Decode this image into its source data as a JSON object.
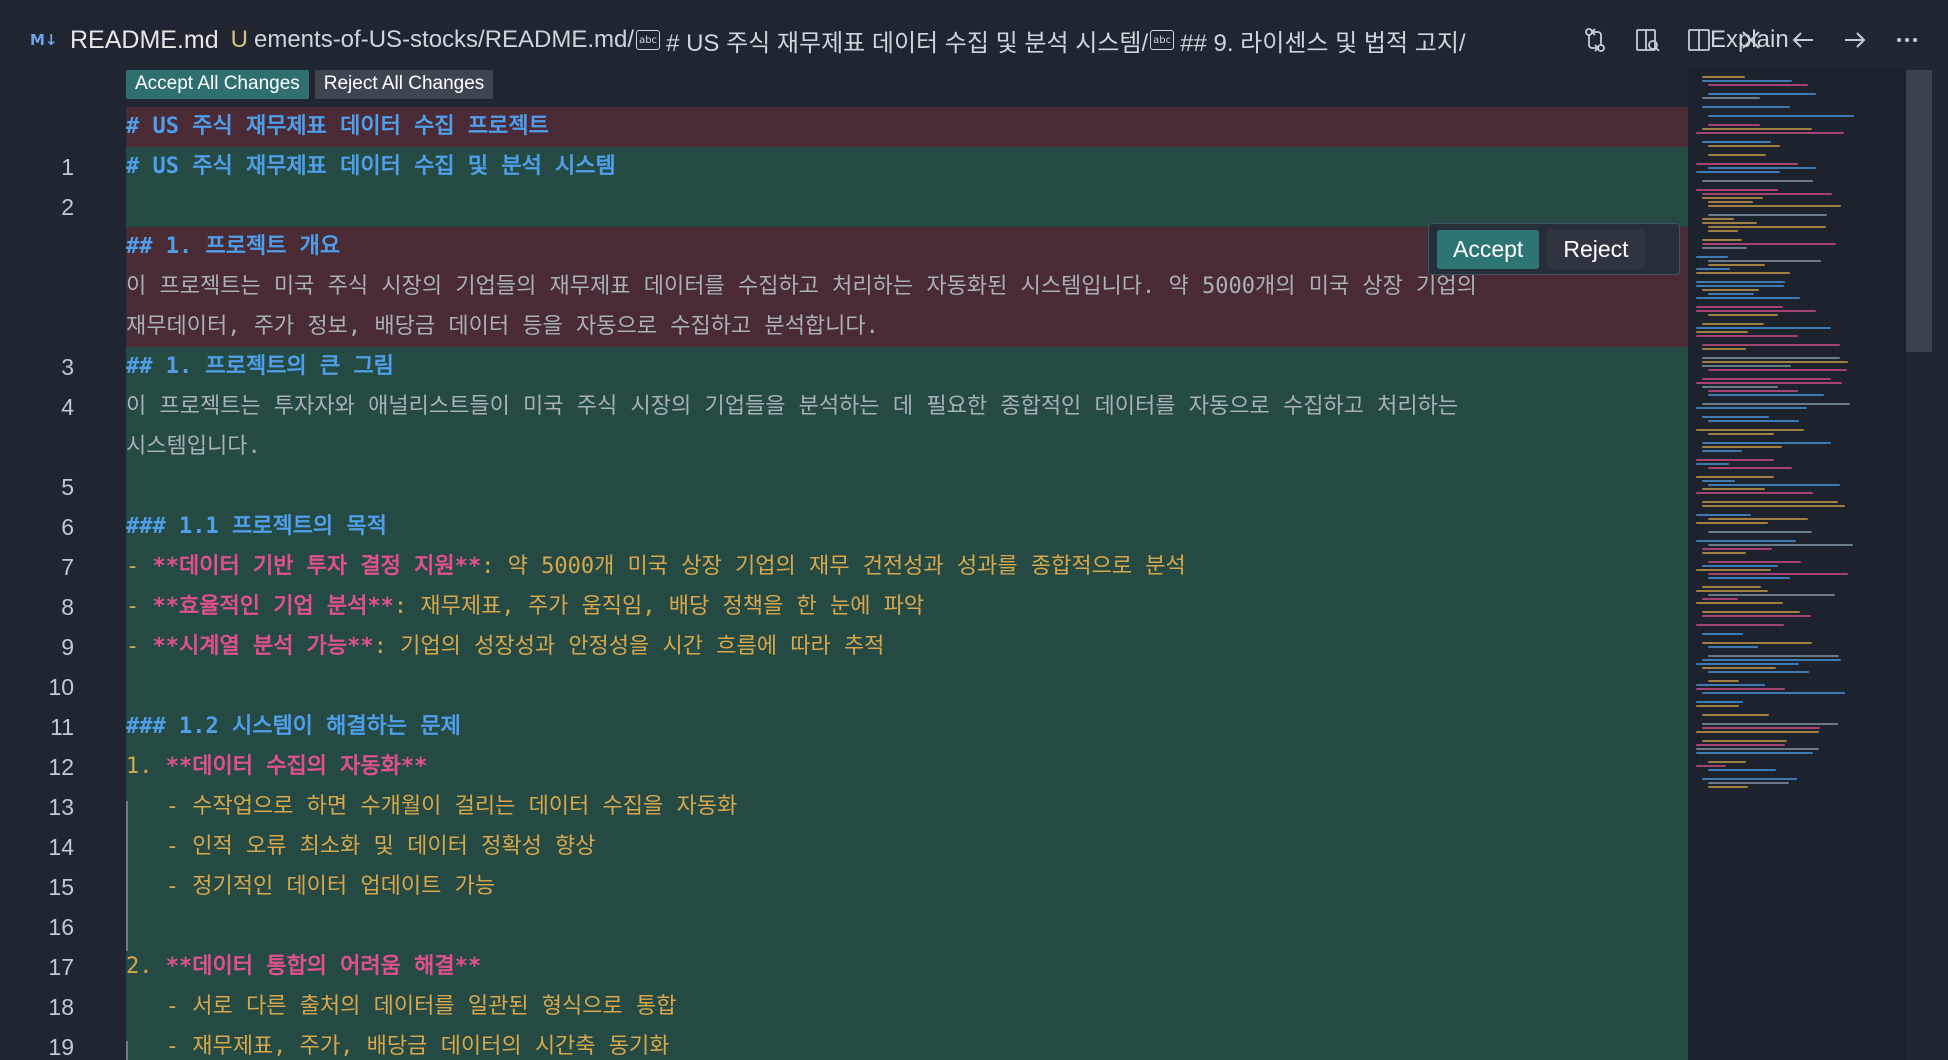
{
  "titlebar": {
    "md_icon": "M↓",
    "file_name": "README.md",
    "file_status": "U",
    "crumbs": [
      {
        "text": "ements-of-US-stocks/README.md/"
      },
      {
        "text": "# US 주식 재무제표 데이터 수집 및 분석 시스템/"
      },
      {
        "text": "## 9. 라이센스 및 법적 고지/"
      }
    ],
    "abc_label": "abc",
    "explain": "Explain"
  },
  "toolbar_icons": [
    "source-control-compare-icon",
    "open-preview-icon",
    "split-editor-icon",
    "close-icon",
    "go-back-icon",
    "go-forward-icon",
    "more-actions-icon"
  ],
  "diff_actions": {
    "accept_all": "Accept All Changes",
    "reject_all": "Reject All Changes"
  },
  "hunk_actions": {
    "accept": "Accept",
    "reject": "Reject"
  },
  "lines": [
    {
      "n": "",
      "kind": "del",
      "segments": [
        {
          "c": "h-blue",
          "t": "# US 주식 재무제표 데이터 수집 프로젝트"
        }
      ]
    },
    {
      "n": "1",
      "kind": "add",
      "segments": [
        {
          "c": "h-blue",
          "t": "# US 주식 재무제표 데이터 수집 및 분석 시스템"
        }
      ]
    },
    {
      "n": "2",
      "kind": "add",
      "segments": []
    },
    {
      "n": "",
      "kind": "del",
      "segments": [
        {
          "c": "h-blue",
          "t": "## 1. 프로젝트 개요"
        }
      ]
    },
    {
      "n": "",
      "kind": "del",
      "segments": [
        {
          "c": "grey",
          "t": "이 프로젝트는 미국 주식 시장의 기업들의 재무제표 데이터를 수집하고 처리하는 자동화된 시스템입니다. 약 5000개의 미국 상장 기업의"
        }
      ]
    },
    {
      "n": "",
      "kind": "del",
      "segments": [
        {
          "c": "grey",
          "t": "재무데이터, 주가 정보, 배당금 데이터 등을 자동으로 수집하고 분석합니다."
        }
      ]
    },
    {
      "n": "3",
      "kind": "add",
      "segments": [
        {
          "c": "h-blue",
          "t": "## 1. 프로젝트의 큰 그림"
        }
      ]
    },
    {
      "n": "4",
      "kind": "add",
      "segments": [
        {
          "c": "grey",
          "t": "이 프로젝트는 투자자와 애널리스트들이 미국 주식 시장의 기업들을 분석하는 데 필요한 종합적인 데이터를 자동으로 수집하고 처리하는"
        }
      ]
    },
    {
      "n": "",
      "kind": "add",
      "segments": [
        {
          "c": "grey",
          "t": "시스템입니다."
        }
      ]
    },
    {
      "n": "5",
      "kind": "add",
      "segments": []
    },
    {
      "n": "6",
      "kind": "add",
      "segments": [
        {
          "c": "h-blue",
          "t": "### 1.1 프로젝트의 목적"
        }
      ]
    },
    {
      "n": "7",
      "kind": "add",
      "segments": [
        {
          "c": "orange",
          "t": "- "
        },
        {
          "c": "pink",
          "t": "**데이터 기반 투자 결정 지원**"
        },
        {
          "c": "orange",
          "t": ": 약 5000개 미국 상장 기업의 재무 건전성과 성과를 종합적으로 분석"
        }
      ]
    },
    {
      "n": "8",
      "kind": "add",
      "segments": [
        {
          "c": "orange",
          "t": "- "
        },
        {
          "c": "pink",
          "t": "**효율적인 기업 분석**"
        },
        {
          "c": "orange",
          "t": ": 재무제표, 주가 움직임, 배당 정책을 한 눈에 파악"
        }
      ]
    },
    {
      "n": "9",
      "kind": "add",
      "segments": [
        {
          "c": "orange",
          "t": "- "
        },
        {
          "c": "pink",
          "t": "**시계열 분석 가능**"
        },
        {
          "c": "orange",
          "t": ": 기업의 성장성과 안정성을 시간 흐름에 따라 추적"
        }
      ]
    },
    {
      "n": "10",
      "kind": "add",
      "segments": []
    },
    {
      "n": "11",
      "kind": "add",
      "segments": [
        {
          "c": "h-blue",
          "t": "### 1.2 시스템이 해결하는 문제"
        }
      ]
    },
    {
      "n": "12",
      "kind": "add",
      "segments": [
        {
          "c": "orange",
          "t": "1. "
        },
        {
          "c": "pink",
          "t": "**데이터 수집의 자동화**"
        }
      ]
    },
    {
      "n": "13",
      "kind": "add",
      "segments": [
        {
          "c": "orange",
          "t": "   - 수작업으로 하면 수개월이 걸리는 데이터 수집을 자동화"
        }
      ]
    },
    {
      "n": "14",
      "kind": "add",
      "segments": [
        {
          "c": "orange",
          "t": "   - 인적 오류 최소화 및 데이터 정확성 향상"
        }
      ]
    },
    {
      "n": "15",
      "kind": "add",
      "segments": [
        {
          "c": "orange",
          "t": "   - 정기적인 데이터 업데이트 가능"
        }
      ]
    },
    {
      "n": "16",
      "kind": "add",
      "segments": []
    },
    {
      "n": "17",
      "kind": "add",
      "segments": [
        {
          "c": "orange",
          "t": "2. "
        },
        {
          "c": "pink",
          "t": "**데이터 통합의 어려움 해결**"
        }
      ]
    },
    {
      "n": "18",
      "kind": "add",
      "segments": [
        {
          "c": "orange",
          "t": "   - 서로 다른 출처의 데이터를 일관된 형식으로 통합"
        }
      ]
    },
    {
      "n": "19",
      "kind": "add",
      "segments": [
        {
          "c": "orange",
          "t": "   - 재무제표, 주가, 배당금 데이터의 시간축 동기화"
        }
      ]
    }
  ],
  "colors": {
    "background": "#1f2631",
    "added_line": "#254a43",
    "removed_line": "#4a2a35",
    "heading": "#4f9eea",
    "bold": "#e0508e",
    "list_text": "#d9a74b",
    "accept_button": "#2d7575"
  }
}
